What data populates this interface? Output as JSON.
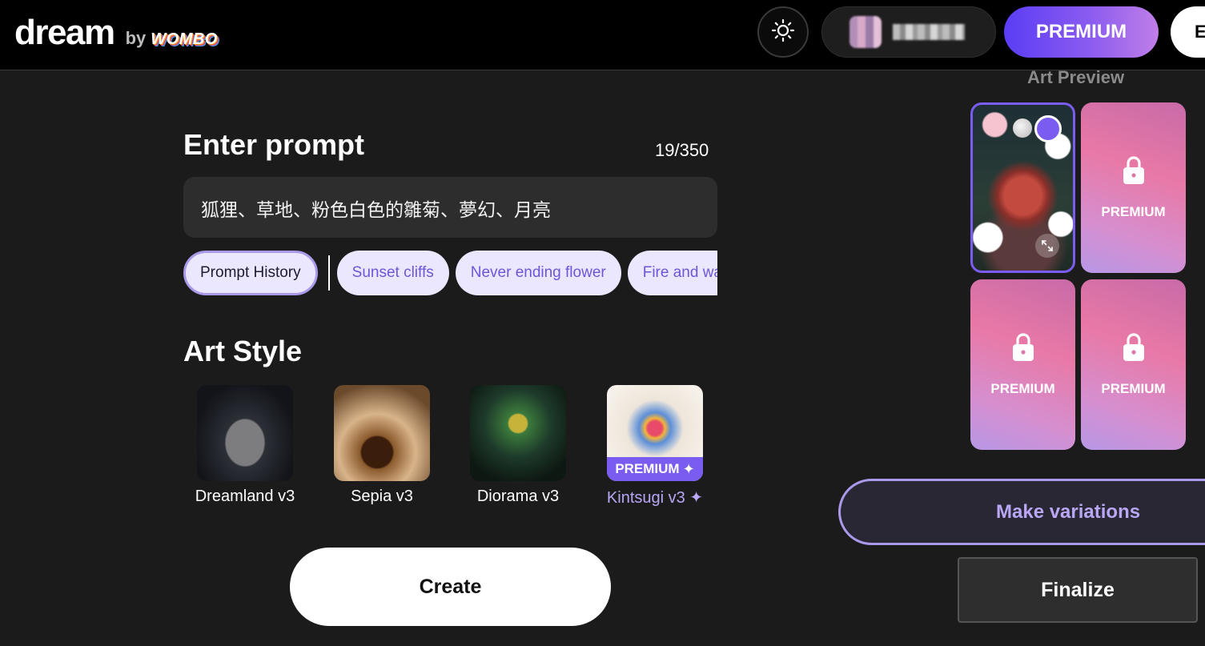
{
  "header": {
    "logo_word": "dream",
    "logo_by": "by",
    "logo_brand": "WOMBO",
    "premium_label": "PREMIUM",
    "extra_label": "E"
  },
  "prompt": {
    "title": "Enter prompt",
    "counter": "19/350",
    "value": "狐狸、草地、粉色白色的雛菊、夢幻、月亮",
    "chips": {
      "history": "Prompt History",
      "suggestions": [
        "Sunset cliffs",
        "Never ending flower",
        "Fire and water"
      ]
    }
  },
  "art_style": {
    "title": "Art Style",
    "styles": [
      {
        "label": "Dreamland v3"
      },
      {
        "label": "Sepia v3"
      },
      {
        "label": "Diorama v3"
      },
      {
        "label": "Kintsugi v3 ✦",
        "badge": "PREMIUM"
      }
    ]
  },
  "create_label": "Create",
  "preview": {
    "title": "Art Preview",
    "locked_label": "PREMIUM",
    "make_variations": "Make variations",
    "finalize": "Finalize"
  },
  "colors": {
    "accent": "#7a5cf0",
    "chip_bg": "#ebe7ff",
    "chip_text": "#6f55d8"
  }
}
